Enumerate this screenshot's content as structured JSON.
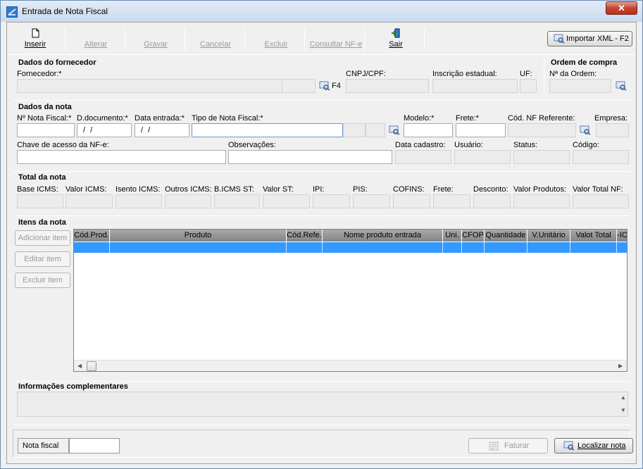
{
  "window": {
    "title": "Entrada de Nota Fiscal",
    "close_label": "✕"
  },
  "toolbar": {
    "inserir": "Inserir",
    "alterar": "Alterar",
    "gravar": "Gravar",
    "cancelar": "Cancelar",
    "excluir": "Excluir",
    "consultar": "Consultar NF-e",
    "sair": "Sair",
    "importar": "Importar XML - F2"
  },
  "fornecedor": {
    "title": "Dados do fornecedor",
    "fornecedor_label": "Fornecedor:*",
    "f4_label": "F4",
    "cnpj_label": "CNPJ/CPF:",
    "ie_label": "Inscrição estadual:",
    "uf_label": "UF:"
  },
  "ordem": {
    "title": "Ordem de compra",
    "numero_label": "Nª da Ordem:"
  },
  "nota": {
    "title": "Dados da nota",
    "numero_label": "Nº Nota Fiscal:*",
    "ddoc_label": "D.documento:*",
    "ddoc_value": "/ /",
    "dentrada_label": "Data entrada:*",
    "dentrada_value": "/ /",
    "tipo_label": "Tipo de Nota Fiscal:*",
    "modelo_label": "Modelo:*",
    "frete_label": "Frete:*",
    "codref_label": "Cód. NF Referente:",
    "empresa_label": "Empresa:",
    "chave_label": "Chave de acesso da NF-e:",
    "obs_label": "Observações:",
    "datacad_label": "Data cadastro:",
    "usuario_label": "Usuário:",
    "status_label": "Status:",
    "codigo_label": "Código:"
  },
  "total": {
    "title": "Total da nota",
    "labels": [
      "Base ICMS:",
      "Valor ICMS:",
      "Isento ICMS:",
      "Outros ICMS:",
      "B.ICMS ST:",
      "Valor ST:",
      "IPI:",
      "PIS:",
      "COFINS:",
      "Frete:",
      "Desconto:",
      "Valor Produtos:",
      "Valor Total NF:"
    ]
  },
  "itens": {
    "title": "Itens da nota",
    "adicionar": "Adicionar item",
    "editar": "Editar item",
    "excluir": "Excluir item",
    "columns": [
      "Cód.Prod.",
      "Produto",
      "Cód.Refe.",
      "Nome produto entrada",
      "Uni.",
      "CFOP",
      "Quantidade",
      "V.Unitário",
      "Valot Total",
      "-IC"
    ]
  },
  "info": {
    "title": "Informações complementares"
  },
  "bottom": {
    "nota_fiscal_label": "Nota fiscal",
    "faturar": "Faturar",
    "localizar": "Localizar nota"
  },
  "colors": {
    "accent_line": "#e8924a",
    "grid_selection": "#3399ff",
    "grid_header": "#a0a0a0"
  }
}
